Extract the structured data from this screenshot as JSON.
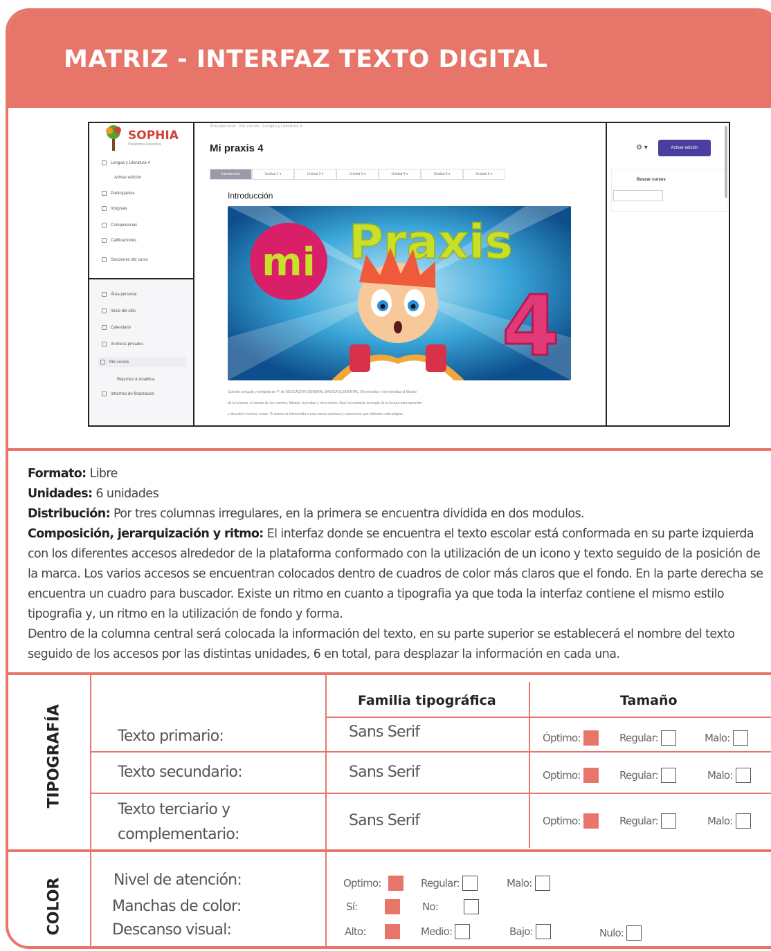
{
  "title": "MATRIZ - INTERFAZ TEXTO DIGITAL",
  "mockup": {
    "brand": "SOPHIA",
    "brand_tagline": "Plataforma Educativa",
    "breadcrumb": "Área personal  ·  Mis cursos  ·  Lengua y Literatura 4",
    "page_title": "Mi praxis 4",
    "intro_label": "Introducción",
    "banner_mi": "mi",
    "banner_praxis": "Praxis",
    "banner_number": "4",
    "action_button": "Activar edición",
    "search_label": "Buscar cursos",
    "tabs": [
      "Introducción",
      "Unidad 1 ▾",
      "Unidad 2 ▾",
      "Unidad 3 ▾",
      "Unidad 4 ▾",
      "Unidad 5 ▾",
      "Unidad 6 ▾"
    ],
    "nav_top": [
      "Lengua y Literatura 4",
      "Activar edición",
      "Participantes",
      "Insignias",
      "Competencias",
      "Calificaciones",
      "Secciones del curso"
    ],
    "nav_bottom": [
      "Área personal",
      "Inicio del sitio",
      "Calendario",
      "Archivos privados",
      "Mis cursos",
      "Reportes & Analítica",
      "Informes de finalización"
    ],
    "paragraph": [
      "Querido amiguito y amiguita de 4° de EDUCACIÓN GENERAL BÁSICA ELEMENTAL. Bienvenidos y bienvenidas al Mundo",
      "de la Lectura, el mundo de los cuentos, fábulas, leyendas y otros textos. Aquí encontrarás la magia de la lectura para aprender",
      "y descubrir muchas cosas. Te damos la bienvenida a esta nueva aventura y esperamos que disfrutes cada página."
    ]
  },
  "description": {
    "formato_label": "Formato:",
    "formato_value": "Libre",
    "unidades_label": "Unidades:",
    "unidades_value": "6 unidades",
    "distribucion_label": "Distribución:",
    "distribucion_value": "Por tres columnas irregulares, en la primera se encuentra dividida en dos modulos.",
    "composicion_label": "Composición, jerarquización y ritmo:",
    "composicion_value": "El interfaz donde se encuentra el texto escolar está conformada en su parte izquierda con los diferentes accesos alrededor de la plataforma conformado con la utilización de un icono y texto seguido de la posición de la marca. Los varios accesos se encuentran colocados dentro de cuadros de color más claros que el fondo. En la parte derecha se encuentra  un cuadro para buscador. Existe un ritmo en cuanto a tipografia ya que toda la interfaz contiene el mismo estilo tipografia y, un ritmo en la utilización de fondo y forma.",
    "central": "Dentro de la columna central será colocada la información del texto, en su parte superior se establecerá el nombre del texto seguido de los accesos por las distintas unidades, 6 en total, para desplazar la información en cada una."
  },
  "typography": {
    "section_label": "TIPOGRAFÍA",
    "col_family": "Familia tipográfica",
    "col_size": "Tamaño",
    "rows": [
      {
        "label": "Texto primario:",
        "family": "Sans Serif",
        "opt1": "Óptimo:",
        "opt2": "Regular:",
        "opt3": "Malo:"
      },
      {
        "label": "Texto secundario:",
        "family": "Sans Serif",
        "opt1": "Optimo:",
        "opt2": "Regular:",
        "opt3": "Malo:"
      },
      {
        "label": "Texto terciario y",
        "label2": "complementario:",
        "family": "Sans Serif",
        "opt1": "Optimo:",
        "opt2": "Regular:",
        "opt3": "Malo:"
      }
    ],
    "selected": [
      "opt1",
      "opt1",
      "opt1"
    ]
  },
  "color": {
    "section_label": "COLOR",
    "labels": [
      "Nivel de atención:",
      "Manchas de color:",
      "Descanso visual:"
    ],
    "attention": {
      "opt1": "Optimo:",
      "opt2": "Regular:",
      "opt3": "Malo:",
      "selected": "opt1"
    },
    "spots": {
      "opt1": "Sí:",
      "opt2": "No:",
      "selected": "opt1"
    },
    "rest": {
      "opt1": "Alto:",
      "opt2": "Medio:",
      "opt3": "Bajo:",
      "opt4": "Nulo:",
      "selected": "opt1"
    }
  },
  "colors": {
    "accent": "#e8756a",
    "button": "#4a3fa0"
  }
}
